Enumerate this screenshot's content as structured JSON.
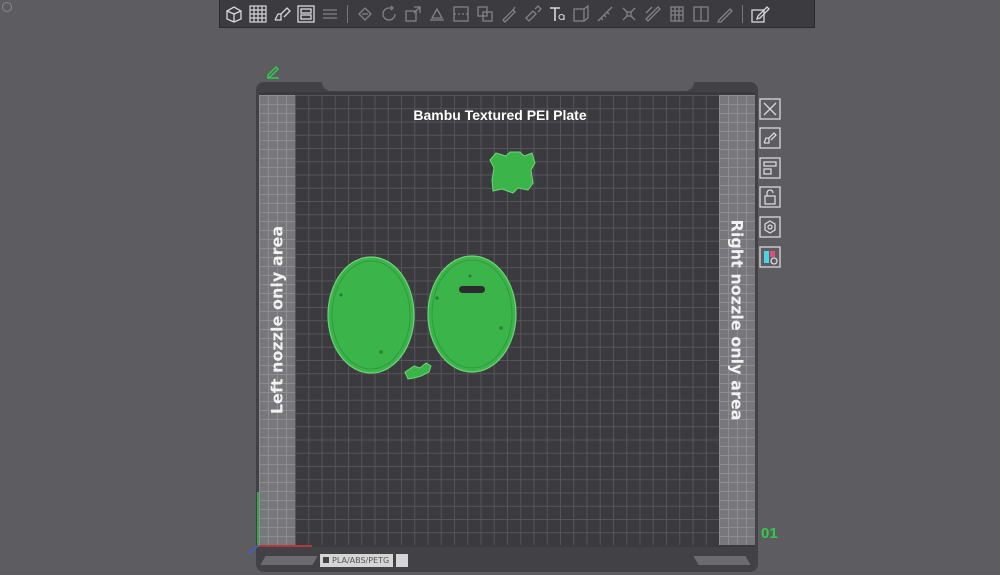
{
  "plate": {
    "title": "Bambu Textured PEI Plate",
    "left_label": "Left nozzle only area",
    "right_label": "Right nozzle only area",
    "index": "01",
    "filament_badge": "PLA/ABS/PETG"
  },
  "toolbar": {
    "tools": [
      "add-cube-icon",
      "grid-icon",
      "auto-orient-icon",
      "arrange-icon",
      "layers-icon",
      "move-icon",
      "rotate-icon",
      "scale-icon",
      "lay-on-face-icon",
      "cut-icon",
      "mesh-boolean-icon",
      "support-paint-icon",
      "seam-paint-icon",
      "text-icon",
      "color-paint-icon",
      "measure-icon",
      "assembly-icon",
      "brim-ears-icon",
      "variable-layer-icon",
      "split-icon",
      "pencil-icon",
      "edit-object-icon"
    ]
  },
  "colors": {
    "background": "#5d5d61",
    "plate_frame": "#414146",
    "model_green": "#3bb54a",
    "plate_index": "#2ecc4a"
  }
}
